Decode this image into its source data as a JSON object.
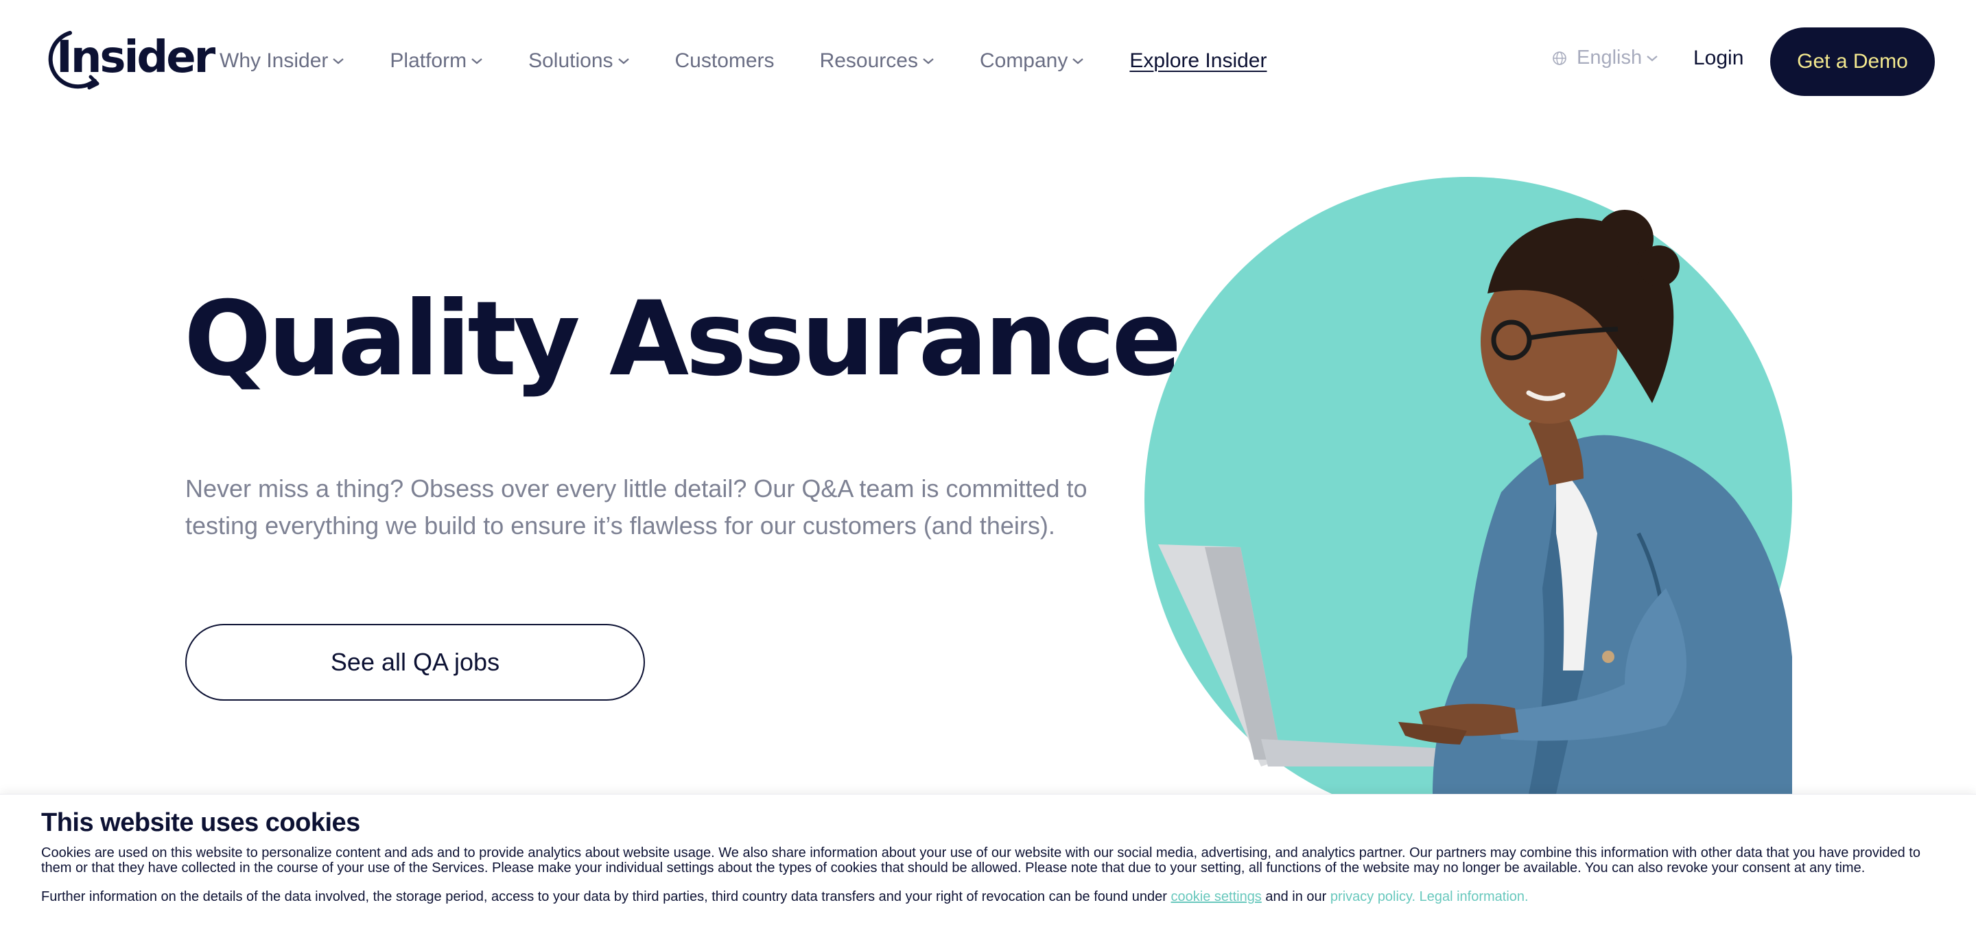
{
  "header": {
    "logo_text": "Insider",
    "nav": [
      {
        "label": "Why Insider",
        "has_dropdown": true
      },
      {
        "label": "Platform",
        "has_dropdown": true
      },
      {
        "label": "Solutions",
        "has_dropdown": true
      },
      {
        "label": "Customers",
        "has_dropdown": false
      },
      {
        "label": "Resources",
        "has_dropdown": true
      },
      {
        "label": "Company",
        "has_dropdown": true
      },
      {
        "label": "Explore Insider",
        "has_dropdown": false
      }
    ],
    "language": {
      "label": "English",
      "icon": "globe-icon"
    },
    "login_label": "Login",
    "demo_label": "Get a Demo"
  },
  "hero": {
    "title": "Quality Assurance",
    "description": "Never miss a thing? Obsess over every little detail? Our Q&A team is committed to testing everything we build to ensure it’s flawless for our customers (and theirs).",
    "cta_label": "See all QA jobs",
    "image": "woman-with-laptop-illustration"
  },
  "cookie_banner": {
    "title": "This website uses cookies",
    "text": "Cookies are used on this website to personalize content and ads and to provide analytics about website usage. We also share information about your use of our website with our social media, advertising, and analytics partner. Our partners may combine this information with other data that you have provided to them or that they have collected in the course of your use of the Services. Please make your individual settings about the types of cookies that should be allowed. Please note that due to your setting, all functions of the website may no longer be available. You can also revoke your consent at any time.",
    "further_prefix": "Further information on the details of the data involved, the storage period, access to your data by third parties, third country data transfers and your right of revocation can be found under",
    "cookie_settings_link": "cookie settings",
    "further_middle": "and in our",
    "privacy_link": "privacy policy.",
    "legal_link": "Legal information."
  },
  "colors": {
    "brand_navy": "#0c1133",
    "accent_yellow": "#f4e98f",
    "teal": "#7ad9ce",
    "muted_text": "#7d8193",
    "link_teal": "#68c8bd"
  }
}
